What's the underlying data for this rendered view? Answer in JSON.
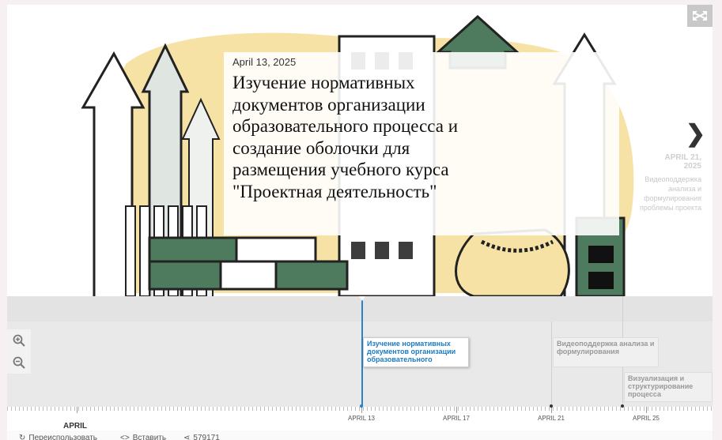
{
  "slide": {
    "date": "April 13, 2025",
    "title": "Изучение нормативных документов организации образовательного процесса и создание оболочки для размещения учебного курса \"Проектная деятельность\"",
    "next_date": "APRIL 21, 2025",
    "next_desc": "Видеоподдержка анализа и формулирования проблемы проекта"
  },
  "timeline": {
    "events": [
      {
        "label": "Изучение нормативных документов организации образовательного"
      },
      {
        "label": "Видеоподдержка анализа и формулирования"
      },
      {
        "label": "Визуализация и структурирование процесса"
      }
    ],
    "ticks": [
      "APRIL 13",
      "APRIL 17",
      "APRIL 21",
      "APRIL 25"
    ],
    "month": "APRIL"
  },
  "footer": {
    "reuse": "Переиспользовать",
    "embed": "Вставить",
    "views": "579171"
  },
  "colors": {
    "accent": "#2a82c8",
    "illustration_yellow": "#f7e2a6",
    "illustration_green": "#4e7a5e"
  },
  "icons": [
    "fullscreen-icon",
    "next-arrow-icon",
    "zoom-in-icon",
    "zoom-out-icon",
    "reuse-icon",
    "embed-icon",
    "share-icon"
  ]
}
